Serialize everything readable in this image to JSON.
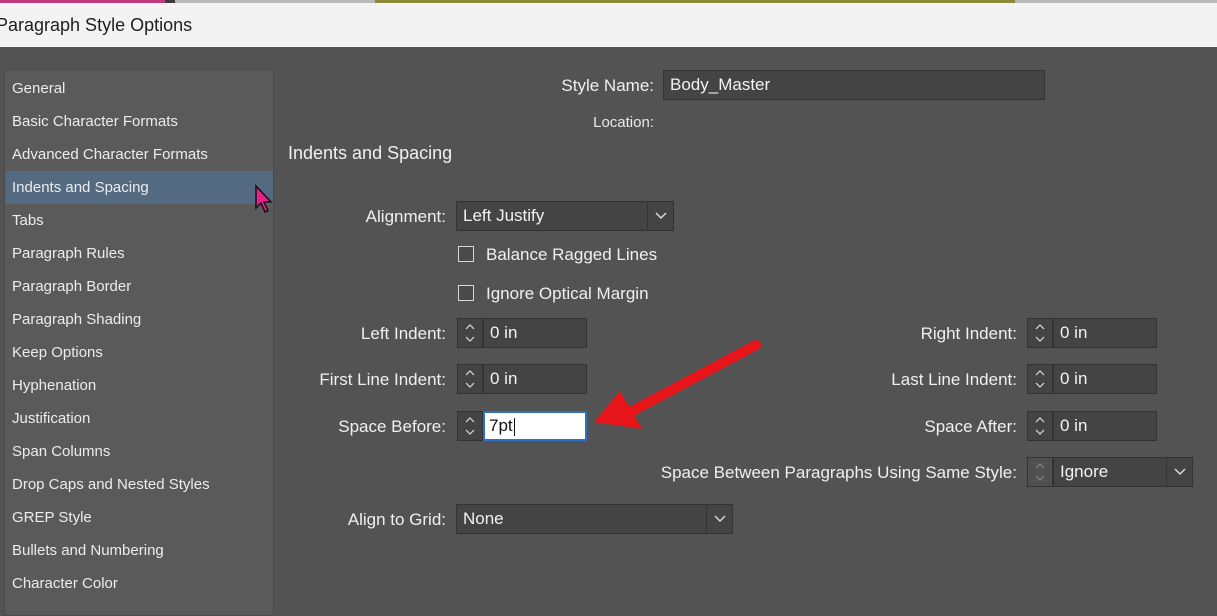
{
  "window": {
    "title": "Paragraph Style Options"
  },
  "sidebar": {
    "items": [
      "General",
      "Basic Character Formats",
      "Advanced Character Formats",
      "Indents and Spacing",
      "Tabs",
      "Paragraph Rules",
      "Paragraph Border",
      "Paragraph Shading",
      "Keep Options",
      "Hyphenation",
      "Justification",
      "Span Columns",
      "Drop Caps and Nested Styles",
      "GREP Style",
      "Bullets and Numbering",
      "Character Color"
    ],
    "selected": "Indents and Spacing"
  },
  "form": {
    "style_name_label": "Style Name:",
    "style_name_value": "Body_Master",
    "location_label": "Location:",
    "section_title": "Indents and Spacing",
    "alignment_label": "Alignment:",
    "alignment_value": "Left Justify",
    "balance_ragged_label": "Balance Ragged Lines",
    "ignore_optical_label": "Ignore Optical Margin",
    "left_indent_label": "Left Indent:",
    "left_indent_value": "0 in",
    "right_indent_label": "Right Indent:",
    "right_indent_value": "0 in",
    "first_line_label": "First Line Indent:",
    "first_line_value": "0 in",
    "last_line_label": "Last Line Indent:",
    "last_line_value": "0 in",
    "space_before_label": "Space Before:",
    "space_before_value": "7pt",
    "space_after_label": "Space After:",
    "space_after_value": "0 in",
    "space_between_label": "Space Between Paragraphs Using Same Style:",
    "space_between_value": "Ignore",
    "align_grid_label": "Align to Grid:",
    "align_grid_value": "None"
  },
  "colors": {
    "background": "#535353",
    "selected_item": "#546a80",
    "annotation_arrow": "#e8151b"
  }
}
